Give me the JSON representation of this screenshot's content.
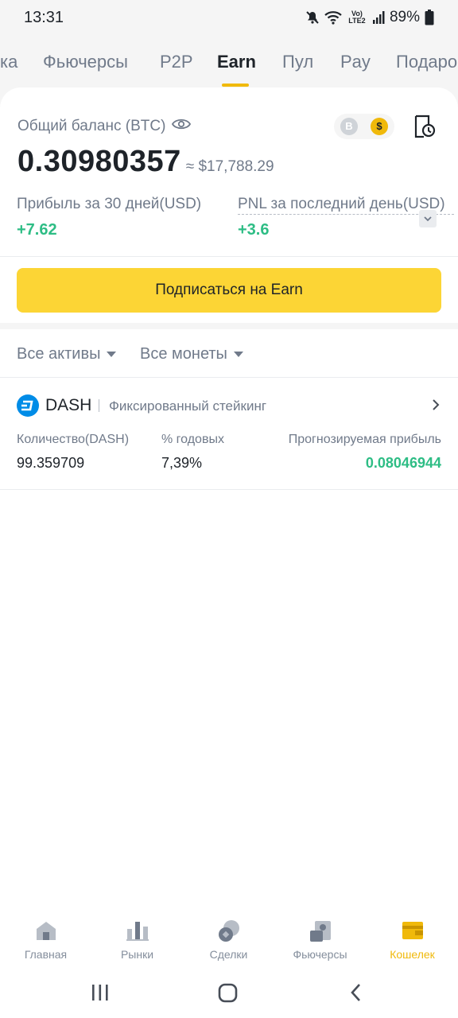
{
  "status_bar": {
    "time": "13:31",
    "network": "Vo) LTE2",
    "battery": "89%"
  },
  "top_tabs": [
    "ка",
    "Фьючерсы",
    "P2P",
    "Earn",
    "Пул",
    "Pay",
    "Подаро"
  ],
  "active_tab": "Earn",
  "balance": {
    "label": "Общий баланс (BTC)",
    "value": "0.30980357",
    "usd": "≈ $17,788.29",
    "toggle_btc": "B",
    "toggle_usd": "$"
  },
  "pnl": {
    "profit30_label": "Прибыль за 30 дней(USD)",
    "profit30_value": "+7.62",
    "lastday_label": "PNL за последний день(USD)",
    "lastday_value": "+3.6"
  },
  "subscribe_button": "Подписаться на Earn",
  "filters": {
    "assets": "Все активы",
    "coins": "Все монеты"
  },
  "asset": {
    "name": "DASH",
    "type": "Фиксированный стейкинг",
    "qty_label": "Количество(DASH)",
    "qty_value": "99.359709",
    "apr_label": "% годовых",
    "apr_value": "7,39%",
    "profit_label": "Прогнозируемая прибыль",
    "profit_value": "0.08046944"
  },
  "bottom_nav": [
    {
      "label": "Главная",
      "icon": "home-icon"
    },
    {
      "label": "Рынки",
      "icon": "markets-icon"
    },
    {
      "label": "Сделки",
      "icon": "trades-icon"
    },
    {
      "label": "Фьючерсы",
      "icon": "futures-icon"
    },
    {
      "label": "Кошелек",
      "icon": "wallet-icon"
    }
  ],
  "colors": {
    "accent": "#f0b90b",
    "button": "#fcd535",
    "positive": "#2ebd85",
    "dash": "#008ce7"
  }
}
